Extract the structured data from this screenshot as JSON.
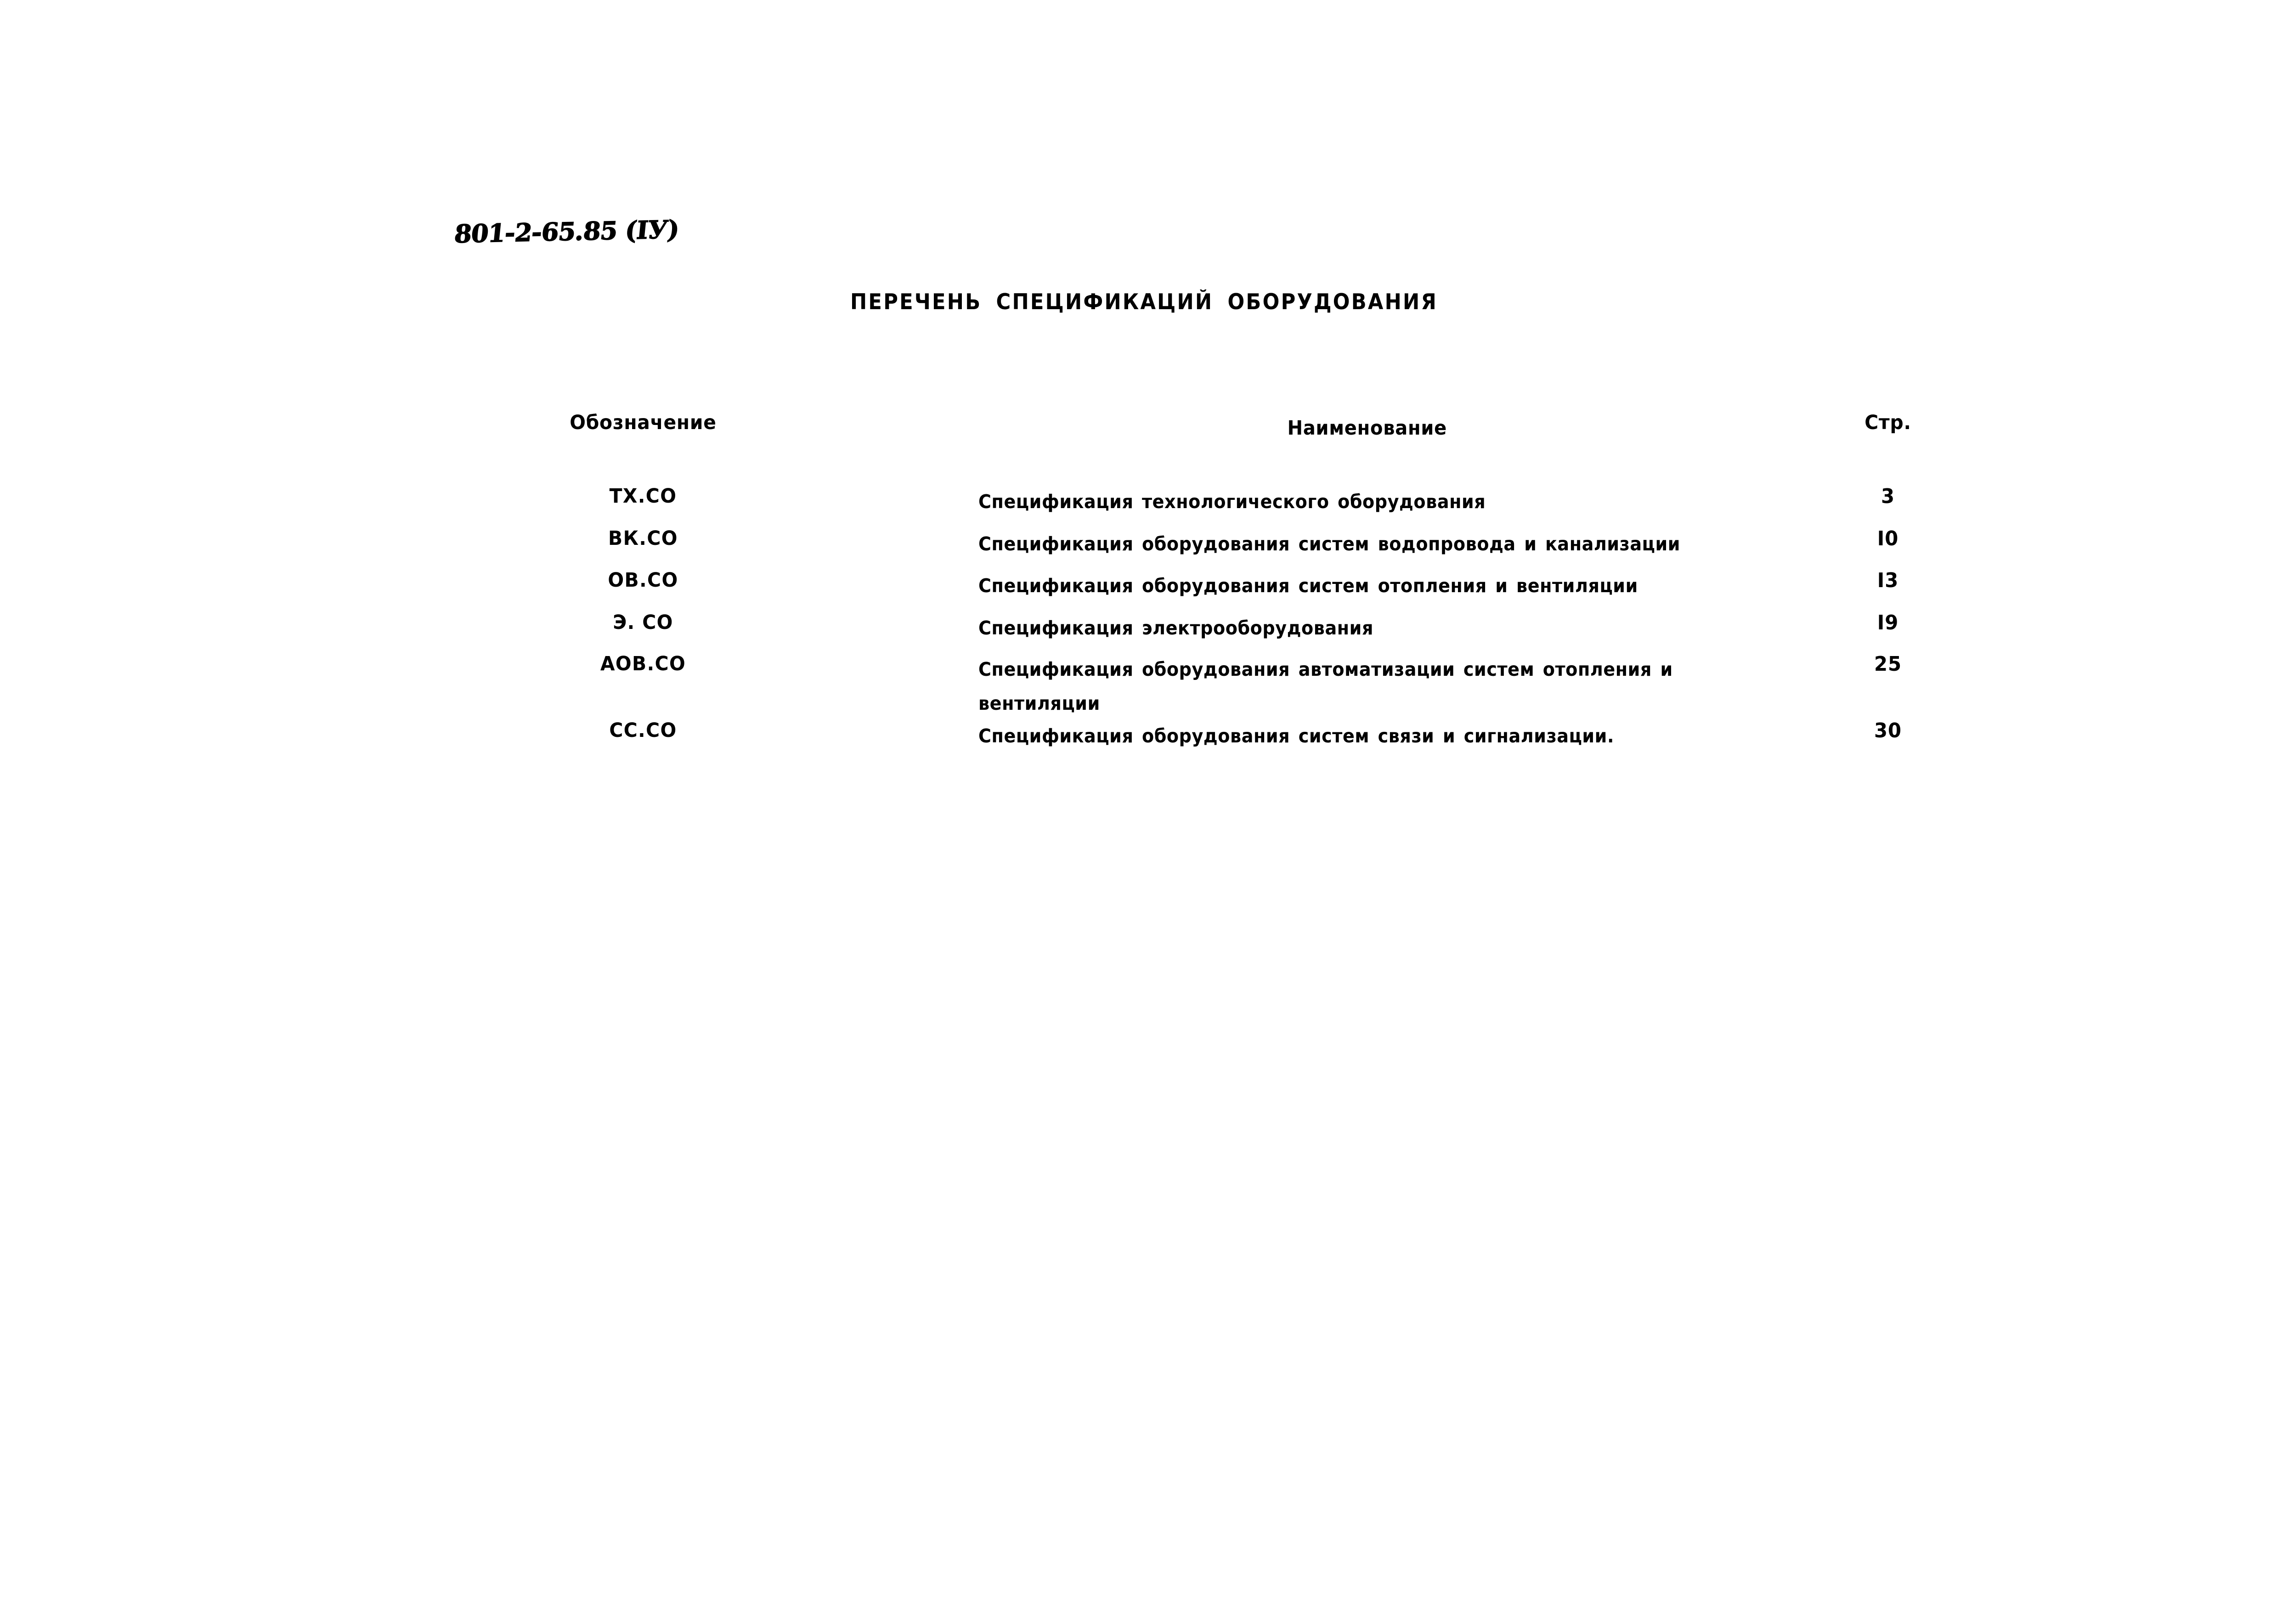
{
  "document": {
    "code": "801-2-65.85 (IУ)",
    "title": "ПЕРЕЧЕНЬ СПЕЦИФИКАЦИЙ ОБОРУДОВАНИЯ"
  },
  "table": {
    "headers": {
      "designation": "Обозначение",
      "name": "Наименование",
      "page": "Стр."
    },
    "rows": [
      {
        "designation": "ТХ.СО",
        "name_line1": "Спецификация технологического оборудования",
        "name_line2": "",
        "page": "3"
      },
      {
        "designation": "ВК.СО",
        "name_line1": "Спецификация оборудования систем водопровода и канализации",
        "name_line2": "",
        "page": "I0"
      },
      {
        "designation": "ОВ.СО",
        "name_line1": "Спецификация оборудования систем отопления и вентиляции",
        "name_line2": "",
        "page": "I3"
      },
      {
        "designation": "Э. СО",
        "name_line1": "Спецификация электрооборудования",
        "name_line2": "",
        "page": "I9"
      },
      {
        "designation": "АОВ.СО",
        "name_line1": "Спецификация оборудования автоматизации систем отопления и",
        "name_line2": "вентиляции",
        "page": "25"
      },
      {
        "designation": "СС.СО",
        "name_line1": "Спецификация оборудования систем связи и сигнализации.",
        "name_line2": "",
        "page": "30"
      }
    ]
  },
  "colors": {
    "paper": "#ffffff",
    "ink": "#0a0a0a"
  }
}
